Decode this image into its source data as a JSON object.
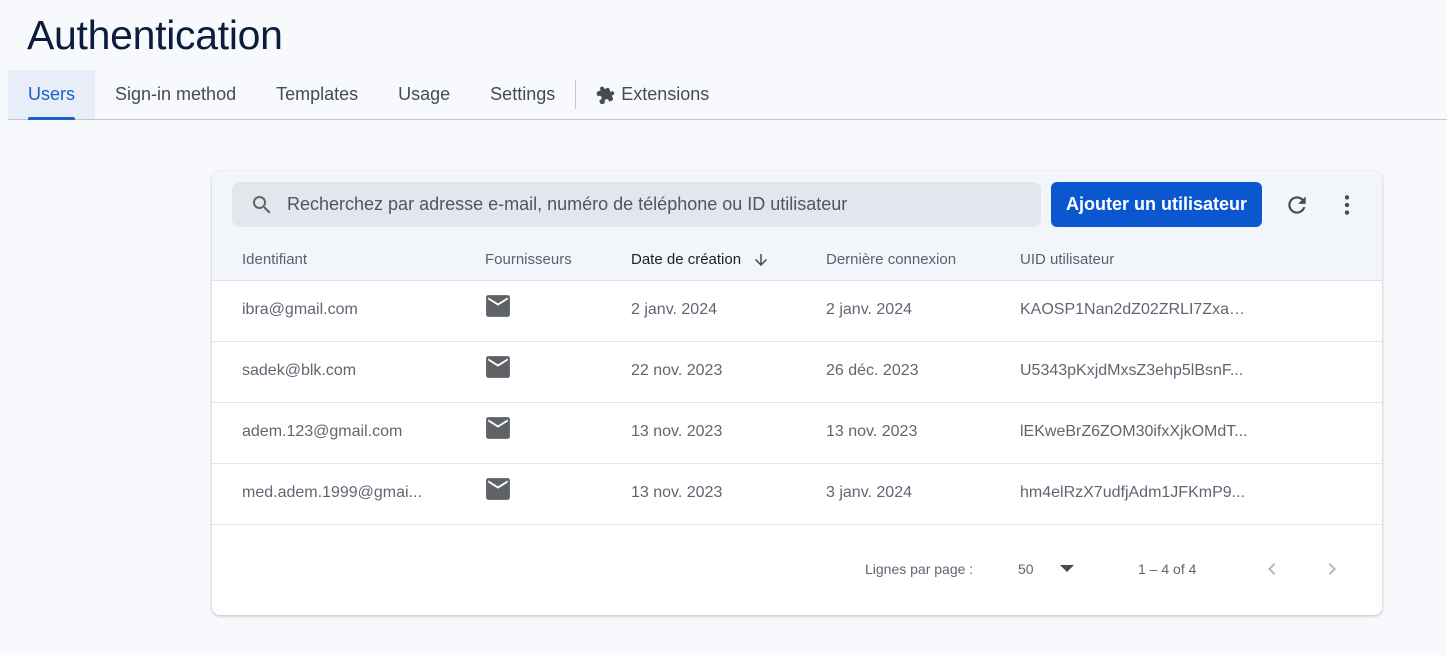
{
  "page": {
    "title": "Authentication"
  },
  "tabs": [
    {
      "label": "Users",
      "active": true
    },
    {
      "label": "Sign-in method"
    },
    {
      "label": "Templates"
    },
    {
      "label": "Usage"
    },
    {
      "label": "Settings"
    },
    {
      "label": "Extensions",
      "icon": "puzzle-icon"
    }
  ],
  "toolbar": {
    "search_placeholder": "Recherchez par adresse e-mail, numéro de téléphone ou ID utilisateur",
    "add_user_label": "Ajouter un utilisateur",
    "refresh_icon": "refresh-icon",
    "more_icon": "more-vert-icon"
  },
  "table": {
    "headers": {
      "identifier": "Identifiant",
      "providers": "Fournisseurs",
      "created": "Date de création",
      "last_sign_in": "Dernière connexion",
      "uid": "UID utilisateur"
    },
    "sorted_column": "created",
    "sort_direction": "descending",
    "rows": [
      {
        "identifier": "ibra@gmail.com",
        "provider": "email-icon",
        "created": "2 janv. 2024",
        "last_sign_in": "2 janv. 2024",
        "uid": "KAOSP1Nan2dZ02ZRLI7ZxaZ..."
      },
      {
        "identifier": "sadek@blk.com",
        "provider": "email-icon",
        "created": "22 nov. 2023",
        "last_sign_in": "26 déc. 2023",
        "uid": "U5343pKxjdMxsZ3ehp5lBsnF..."
      },
      {
        "identifier": "adem.123@gmail.com",
        "provider": "email-icon",
        "created": "13 nov. 2023",
        "last_sign_in": "13 nov. 2023",
        "uid": "lEKweBrZ6ZOM30ifxXjkOMdT..."
      },
      {
        "identifier": "med.adem.1999@gmai...",
        "provider": "email-icon",
        "created": "13 nov. 2023",
        "last_sign_in": "3 janv. 2024",
        "uid": "hm4elRzX7udfjAdm1JFKmP9..."
      }
    ]
  },
  "pagination": {
    "rows_per_page_label": "Lignes par page :",
    "rows_per_page": "50",
    "range": "1 – 4 of 4"
  },
  "colors": {
    "accent": "#1a5fd0",
    "button": "#0b57d0",
    "background": "#f8f9fc"
  }
}
